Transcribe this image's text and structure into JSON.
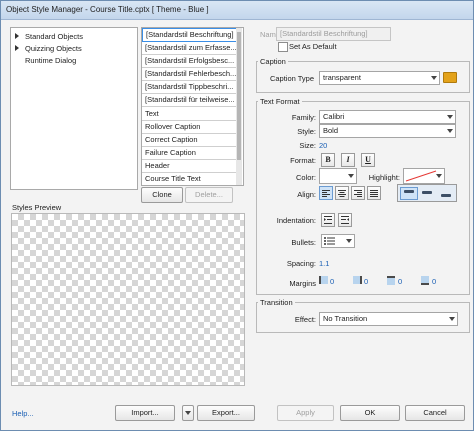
{
  "window": {
    "title": "Object Style Manager - Course Title.cptx [ Theme - Blue ]"
  },
  "tree": {
    "items": [
      {
        "label": "Standard Objects",
        "expandable": true
      },
      {
        "label": "Quizzing Objects",
        "expandable": true
      },
      {
        "label": "Runtime Dialog",
        "expandable": false
      }
    ]
  },
  "styles": {
    "items": [
      "[Standardstil Beschriftung]",
      "[Standardstil zum Erfasse...",
      "[Standardstil Erfolgsbesc...",
      "[Standardstil Fehlerbesch...",
      "[Standardstil Tippbeschri...",
      "[Standardstil für teilweise...",
      "Text",
      "Rollover Caption",
      "Correct Caption",
      "Failure Caption",
      "Header",
      "Course Title Text"
    ],
    "selected_index": 0,
    "clone_label": "Clone",
    "delete_label": "Delete..."
  },
  "preview": {
    "label": "Styles Preview"
  },
  "name": {
    "label": "Name",
    "value": "[Standardstil Beschriftung]",
    "set_default_label": "Set As Default"
  },
  "caption": {
    "section_label": "Caption",
    "type_label": "Caption Type",
    "type_value": "transparent"
  },
  "text_format": {
    "section_label": "Text Format",
    "family_label": "Family:",
    "family_value": "Calibri",
    "style_label": "Style:",
    "style_value": "Bold",
    "size_label": "Size:",
    "size_value": "20",
    "format_label": "Format:",
    "bold": "B",
    "italic": "I",
    "underline": "U",
    "color_label": "Color:",
    "highlight_label": "Highlight:",
    "align_label": "Align:",
    "indentation_label": "Indentation:",
    "bullets_label": "Bullets:",
    "spacing_label": "Spacing:",
    "spacing_value": "1.1",
    "margins_label": "Margins",
    "margin_values": [
      "0",
      "0",
      "0",
      "0"
    ],
    "color_swatch": "#ffffff",
    "highlight_color": "#e53935"
  },
  "transition": {
    "section_label": "Transition",
    "effect_label": "Effect:",
    "effect_value": "No Transition"
  },
  "footer": {
    "help_label": "Help...",
    "import_label": "Import...",
    "export_label": "Export...",
    "apply_label": "Apply",
    "ok_label": "OK",
    "cancel_label": "Cancel"
  }
}
